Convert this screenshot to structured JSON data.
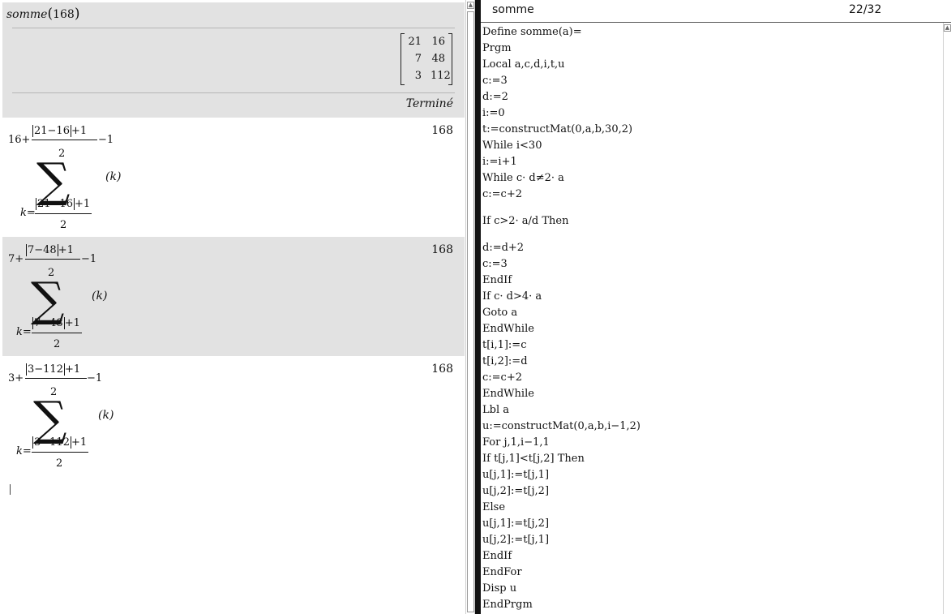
{
  "calculator": {
    "command": {
      "name": "somme",
      "arg": "168"
    },
    "matrix": [
      [
        "21",
        "16"
      ],
      [
        "7",
        "48"
      ],
      [
        "3",
        "112"
      ]
    ],
    "status": "Terminé",
    "entries": [
      {
        "start": "16",
        "numer": "21−16",
        "lower": "21−16",
        "result": "168"
      },
      {
        "start": "7",
        "numer": "7−48",
        "lower": "7−48",
        "result": "168"
      },
      {
        "start": "3",
        "numer": "3−112",
        "lower": "3−112",
        "result": "168"
      }
    ],
    "plus_one": "+1",
    "minus_one": "−1",
    "denominator": "2",
    "index_var": "k=",
    "summand": "(k)",
    "sigma": "∑",
    "plus": "+",
    "scroll_up": "▲"
  },
  "editor": {
    "title": "somme",
    "page": "22/32",
    "lines": [
      "Define somme(a)=",
      "Prgm",
      "Local a,c,d,i,t,u",
      "c:=3",
      "d:=2",
      "i:=0",
      "t:=constructMat(0,a,b,30,2)",
      "While i<30",
      "i:=i+1",
      "While c· d≠2· a",
      "c:=c+2",
      "If c>2· a/d Then",
      "d:=d+2",
      "c:=3",
      "EndIf",
      "If c· d>4· a",
      "Goto a",
      "EndWhile",
      "t[i,1]:=c",
      "t[i,2]:=d",
      "c:=c+2",
      "EndWhile",
      "Lbl a",
      "u:=constructMat(0,a,b,i−1,2)",
      "For j,1,i−1,1",
      "If t[j,1]<t[j,2] Then",
      "u[j,1]:=t[j,1]",
      "u[j,2]:=t[j,2]",
      "Else",
      "u[j,1]:=t[j,2]",
      "u[j,2]:=t[j,1]",
      "EndIf",
      "EndFor",
      "Disp u",
      "EndPrgm"
    ]
  }
}
